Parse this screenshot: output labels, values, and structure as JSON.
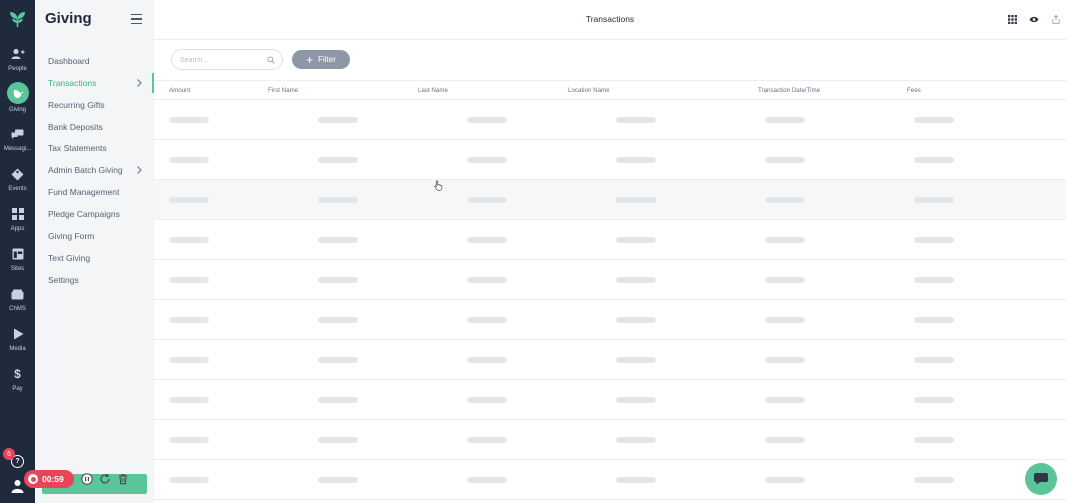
{
  "app": {
    "section_title": "Giving",
    "brand_color": "#5bc59a",
    "rail_color": "#1f2a3c"
  },
  "rail": {
    "items": [
      {
        "label": "People",
        "icon": "people-icon"
      },
      {
        "label": "Giving",
        "icon": "giving-icon",
        "active": true
      },
      {
        "label": "Messagi...",
        "icon": "messaging-icon"
      },
      {
        "label": "Events",
        "icon": "events-icon"
      },
      {
        "label": "Apps",
        "icon": "apps-icon"
      },
      {
        "label": "Sites",
        "icon": "sites-icon"
      },
      {
        "label": "ChMS",
        "icon": "chms-icon"
      },
      {
        "label": "Media",
        "icon": "media-icon"
      },
      {
        "label": "Pay",
        "icon": "pay-icon"
      }
    ],
    "notification_count": "6",
    "help_label": "?"
  },
  "sidenav": {
    "items": [
      {
        "label": "Dashboard"
      },
      {
        "label": "Transactions",
        "active": true,
        "has_chevron": true
      },
      {
        "label": "Recurring Gifts"
      },
      {
        "label": "Bank Deposits"
      },
      {
        "label": "Tax Statements"
      },
      {
        "label": "Admin Batch Giving",
        "has_chevron": true
      },
      {
        "label": "Fund Management"
      },
      {
        "label": "Pledge Campaigns"
      },
      {
        "label": "Giving Form"
      },
      {
        "label": "Text Giving"
      },
      {
        "label": "Settings"
      }
    ]
  },
  "header": {
    "title": "Transactions",
    "icons": [
      "grid-icon",
      "eye-icon",
      "export-icon"
    ]
  },
  "toolbar": {
    "search_placeholder": "Search...",
    "filter_label": "Filter"
  },
  "table": {
    "columns": [
      "Amount",
      "First Name",
      "Last Name",
      "Location Name",
      "Transaction Date/Time",
      "Fees"
    ],
    "loading_rows": 10,
    "hover_row_index": 2
  },
  "recorder": {
    "time": "00:59",
    "color": "#e8455a"
  }
}
